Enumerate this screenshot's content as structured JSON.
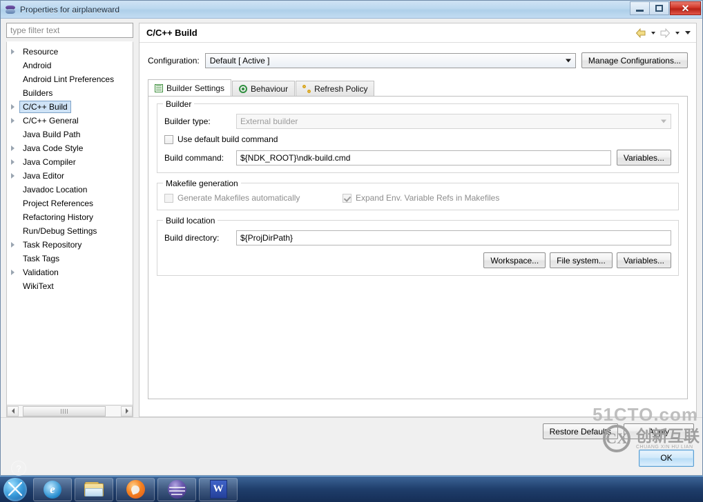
{
  "window": {
    "title": "Properties for airplaneward",
    "icon": "eclipse-properties-icon",
    "minimize_label": "",
    "maximize_label": "",
    "close_label": "✕"
  },
  "sidebar": {
    "filter": {
      "placeholder": "type filter text",
      "value": ""
    },
    "items": [
      {
        "label": "Resource",
        "expandable": true,
        "selected": false
      },
      {
        "label": "Android",
        "expandable": false,
        "selected": false
      },
      {
        "label": "Android Lint Preferences",
        "expandable": false,
        "selected": false
      },
      {
        "label": "Builders",
        "expandable": false,
        "selected": false
      },
      {
        "label": "C/C++ Build",
        "expandable": true,
        "selected": true
      },
      {
        "label": "C/C++ General",
        "expandable": true,
        "selected": false
      },
      {
        "label": "Java Build Path",
        "expandable": false,
        "selected": false
      },
      {
        "label": "Java Code Style",
        "expandable": true,
        "selected": false
      },
      {
        "label": "Java Compiler",
        "expandable": true,
        "selected": false
      },
      {
        "label": "Java Editor",
        "expandable": true,
        "selected": false
      },
      {
        "label": "Javadoc Location",
        "expandable": false,
        "selected": false
      },
      {
        "label": "Project References",
        "expandable": false,
        "selected": false
      },
      {
        "label": "Refactoring History",
        "expandable": false,
        "selected": false
      },
      {
        "label": "Run/Debug Settings",
        "expandable": false,
        "selected": false
      },
      {
        "label": "Task Repository",
        "expandable": true,
        "selected": false
      },
      {
        "label": "Task Tags",
        "expandable": false,
        "selected": false
      },
      {
        "label": "Validation",
        "expandable": true,
        "selected": false
      },
      {
        "label": "WikiText",
        "expandable": false,
        "selected": false
      }
    ]
  },
  "page": {
    "title": "C/C++ Build",
    "nav": {
      "back_icon": "back-arrow-icon",
      "back_menu_icon": "chevron-down-icon",
      "forward_icon": "forward-arrow-icon",
      "forward_menu_icon": "chevron-down-icon",
      "view_menu_icon": "chevron-down-icon"
    },
    "configuration": {
      "label": "Configuration:",
      "value": "Default  [ Active ]",
      "manage_button": "Manage Configurations..."
    },
    "tabs": [
      {
        "label": "Builder Settings",
        "icon": "list-settings-icon",
        "active": true
      },
      {
        "label": "Behaviour",
        "icon": "target-icon",
        "active": false
      },
      {
        "label": "Refresh Policy",
        "icon": "refresh-icon",
        "active": false
      }
    ],
    "builder_group": {
      "legend": "Builder",
      "builder_type_label": "Builder type:",
      "builder_type_value": "External builder",
      "use_default_label": "Use default build command",
      "use_default_checked": false,
      "build_command_label": "Build command:",
      "build_command_value": "${NDK_ROOT}\\ndk-build.cmd",
      "variables_button": "Variables..."
    },
    "makefile_group": {
      "legend": "Makefile generation",
      "generate_label": "Generate Makefiles automatically",
      "generate_checked": false,
      "expand_label": "Expand Env. Variable Refs in Makefiles",
      "expand_checked": true
    },
    "build_location_group": {
      "legend": "Build location",
      "build_dir_label": "Build directory:",
      "build_dir_value": "${ProjDirPath}",
      "workspace_button": "Workspace...",
      "filesystem_button": "File system...",
      "variables_button": "Variables..."
    },
    "footer": {
      "restore_defaults": "Restore Defaults",
      "apply": "Apply",
      "ok": "OK"
    }
  },
  "watermark": {
    "site": "51CTO.com",
    "logo_letter": "CX",
    "brand_cn": "创新互联",
    "brand_py": "CHUANG XIN HU LIAN"
  },
  "taskbar": {
    "start_icon": "windows-start-orb",
    "items": [
      {
        "name": "internet-explorer",
        "glyph": "e"
      },
      {
        "name": "windows-explorer",
        "glyph": ""
      },
      {
        "name": "firefox",
        "glyph": ""
      },
      {
        "name": "eclipse",
        "glyph": ""
      },
      {
        "name": "wps-writer",
        "glyph": "W"
      }
    ],
    "tray_help_glyph": "?"
  }
}
